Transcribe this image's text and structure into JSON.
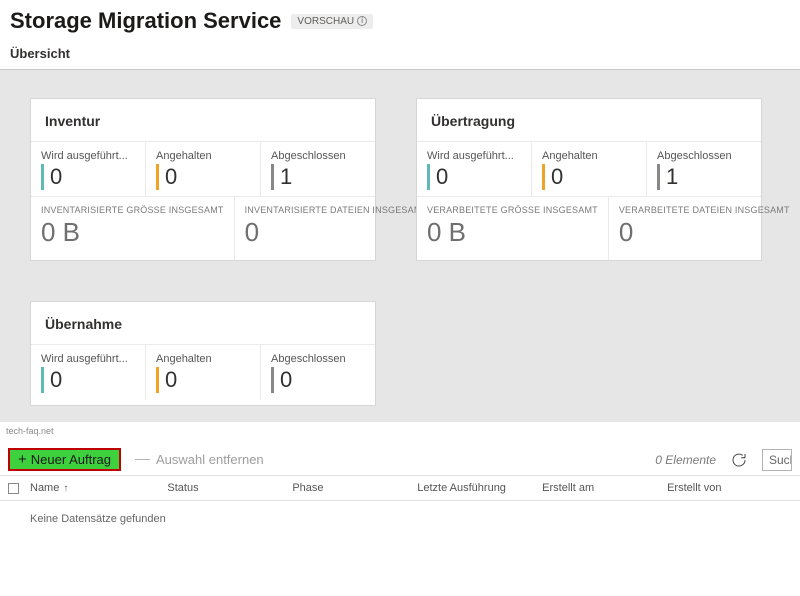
{
  "header": {
    "title": "Storage Migration Service",
    "preview_label": "VORSCHAU"
  },
  "subheader": "Übersicht",
  "colors": {
    "running": "#5fbab5",
    "paused": "#f0a427",
    "completed": "#8a8886"
  },
  "cards": {
    "inventory": {
      "title": "Inventur",
      "running_label": "Wird ausgeführt...",
      "running_value": "0",
      "paused_label": "Angehalten",
      "paused_value": "0",
      "completed_label": "Abgeschlossen",
      "completed_value": "1",
      "total_size_label": "INVENTARISIERTE GRÖSSE INSGESAMT",
      "total_size_value": "0 B",
      "total_files_label": "INVENTARISIERTE DATEIEN INSGESAMT",
      "total_files_value": "0"
    },
    "transfer": {
      "title": "Übertragung",
      "running_label": "Wird ausgeführt...",
      "running_value": "0",
      "paused_label": "Angehalten",
      "paused_value": "0",
      "completed_label": "Abgeschlossen",
      "completed_value": "1",
      "total_size_label": "VERARBEITETE GRÖSSE INSGESAMT",
      "total_size_value": "0 B",
      "total_files_label": "VERARBEITETE DATEIEN INSGESAMT",
      "total_files_value": "0"
    },
    "cutover": {
      "title": "Übernahme",
      "running_label": "Wird ausgeführt...",
      "running_value": "0",
      "paused_label": "Angehalten",
      "paused_value": "0",
      "completed_label": "Abgeschlossen",
      "completed_value": "0"
    }
  },
  "watermark": "tech-faq.net",
  "toolbar": {
    "new_label": "Neuer Auftrag",
    "remove_label": "Auswahl entfernen",
    "count_label": "0 Elemente",
    "search_placeholder": "Suchen"
  },
  "grid": {
    "columns": {
      "name": "Name",
      "name_sort_indicator": "↑",
      "status": "Status",
      "phase": "Phase",
      "last_run": "Letzte Ausführung",
      "created_on": "Erstellt am",
      "created_by": "Erstellt von"
    },
    "empty_message": "Keine Datensätze gefunden"
  }
}
